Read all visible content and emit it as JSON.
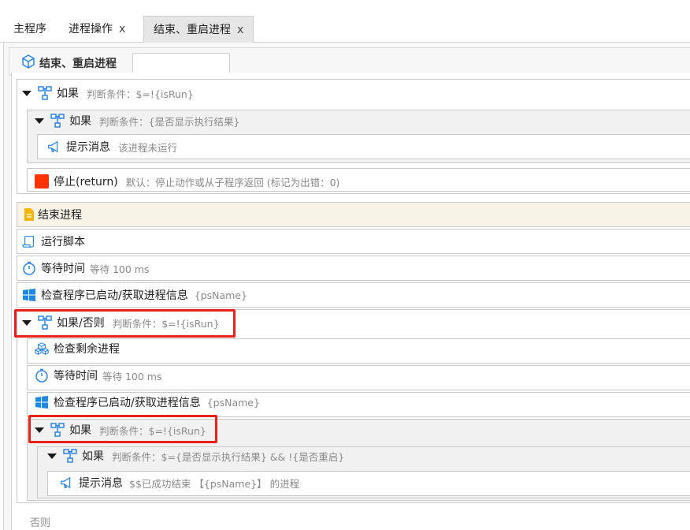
{
  "tabs": [
    {
      "label": "主程序",
      "closable": false,
      "active": false
    },
    {
      "label": "进程操作",
      "closable": true,
      "active": false
    },
    {
      "label": "结束、重启进程",
      "closable": true,
      "active": true
    }
  ],
  "tab_close_glyph": "x",
  "panel": {
    "title": "结束、重启进程",
    "icon": "cube-icon",
    "search_value": ""
  },
  "nodes": {
    "if1": {
      "title": "如果",
      "cond": "判断条件：$=!{isRun}"
    },
    "if2": {
      "title": "如果",
      "cond": "判断条件：{是否显示执行结果}"
    },
    "msg1": {
      "title": "提示消息",
      "cond": "该进程未运行"
    },
    "stop": {
      "title": "停止(return)",
      "cond": "默认：停止动作或从子程序返回 (标记为出错：0)"
    },
    "endProc": {
      "title": "结束进程"
    },
    "script": {
      "title": "运行脚本"
    },
    "wait1": {
      "title": "等待时间",
      "cond": "等待 100 ms"
    },
    "check1": {
      "title": "检查程序已启动/获取进程信息",
      "cond": "{psName}"
    },
    "ifElse": {
      "title": "如果/否则",
      "cond": "判断条件：$=!{isRun}"
    },
    "checkRemain": {
      "title": "检查剩余进程"
    },
    "wait2": {
      "title": "等待时间",
      "cond": "等待 100 ms"
    },
    "check2": {
      "title": "检查程序已启动/获取进程信息",
      "cond": "{psName}"
    },
    "if3": {
      "title": "如果",
      "cond": "判断条件：$=!{isRun}"
    },
    "if4": {
      "title": "如果",
      "cond": "判断条件：$={是否显示执行结果} && !{是否重启}"
    },
    "msg2": {
      "title": "提示消息",
      "cond": "$$已成功结束 【{psName}】 的进程"
    },
    "else": {
      "title": "否则"
    }
  },
  "colors": {
    "highlight": "#e8211a",
    "stop": "#ff3300",
    "accent_blue": "#2e86de",
    "doc_yellow": "#f2b705"
  }
}
